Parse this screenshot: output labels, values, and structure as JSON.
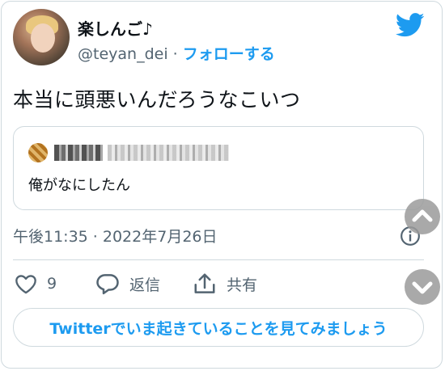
{
  "author": {
    "name": "楽しんご♪",
    "handle": "@teyan_dei",
    "separator": "·",
    "follow_label": "フォローする"
  },
  "tweet": {
    "text": "本当に頭悪いんだろうなこいつ",
    "time": "午後11:35 · 2022年7月26日"
  },
  "quoted_tweet": {
    "text": "俺がなにしたん"
  },
  "actions": {
    "like_count": "9",
    "reply_label": "返信",
    "share_label": "共有"
  },
  "cta_label": "Twitterでいま起きていることを見てみましょう",
  "colors": {
    "accent": "#1d9bf0",
    "muted": "#536471",
    "border": "#cfd9de"
  },
  "icons": [
    "twitter-bird-icon",
    "info-icon",
    "heart-icon",
    "reply-icon",
    "share-icon",
    "chevron-up-icon",
    "chevron-down-icon"
  ]
}
